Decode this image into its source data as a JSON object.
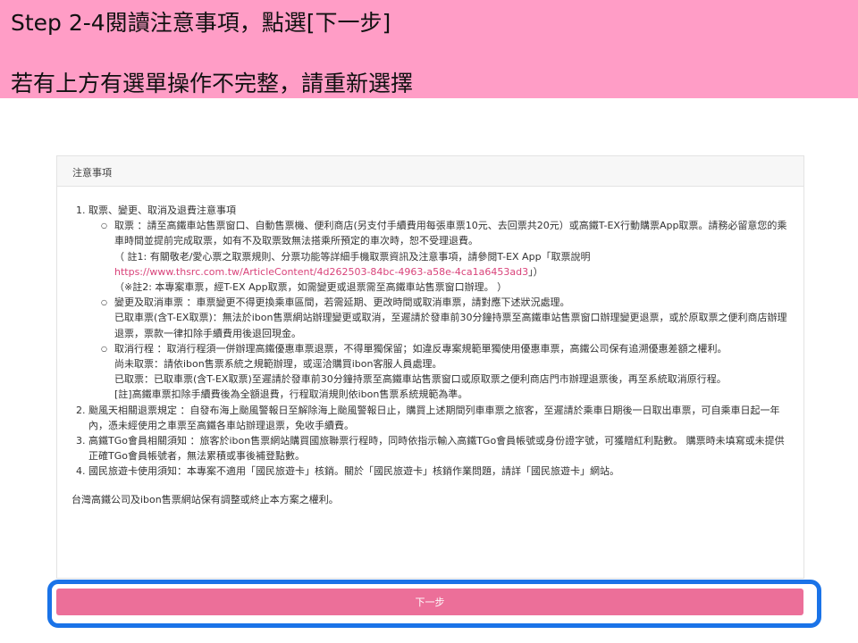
{
  "banner": {
    "line1": "Step 2-4閱讀注意事項，點選[下一步]",
    "line2": "若有上方有選單操作不完整，請重新選擇"
  },
  "panel": {
    "header": "注意事項",
    "items": [
      {
        "title": "取票、變更、取消及退費注意事項",
        "sub": [
          {
            "lines": [
              "取票 ：請至高鐵車站售票窗口、自動售票機、便利商店(另支付手續費用每張車票10元、去回票共20元）或高鐵T-EX行動購票App取票。請務必留意您的乘車時間並提前完成取票，如有不及取票致無法搭乘所預定的車次時，恕不受理退費。",
              "（ 註1: 有關敬老/愛心票之取票規則、分票功能等詳細手機取票資訊及注意事項，請參閱T-EX App「取票說明",
              "https://www.thsrc.com.tw/ArticleContent/4d262503-84bc-4963-a58e-4ca1a6453ad3",
              "」）",
              "（※註2: 本專案車票，經T-EX App取票，如需變更或退票需至高鐵車站售票窗口辦理。 ）"
            ]
          },
          {
            "lines": [
              "變更及取消車票 ：車票變更不得更換乘車區間，若需延期、更改時間或取消車票，請對應下述狀況處理。",
              "已取車票(含T-EX取票)：無法於ibon售票網站辦理變更或取消，至遲請於發車前30分鐘持票至高鐵車站售票窗口辦理變更退票，或於原取票之便利商店辦理退票，票款一律扣除手續費用後退回現金。"
            ]
          },
          {
            "lines": [
              "取消行程 ：取消行程須一併辦理高鐵優惠車票退票，不得單獨保留；如違反專案規範單獨使用優惠車票，高鐵公司保有追溯優惠差額之權利。",
              "尚未取票：請依ibon售票系統之規範辦理，或逕洽購買ibon客服人員處理。",
              "已取票：已取車票(含T-EX取票)至遲請於發車前30分鐘持票至高鐵車站售票窗口或原取票之便利商店門市辦理退票後，再至系統取消原行程。",
              "[註]高鐵車票扣除手續費後為全額退費，行程取消規則依ibon售票系統規範為準。"
            ]
          }
        ]
      },
      {
        "title": "颱風天相關退票規定 ：自發布海上颱風警報日至解除海上颱風警報日止，購買上述期間列車車票之旅客，至遲請於乘車日期後一日取出車票，可自乘車日起一年內，憑未經使用之車票至高鐵各車站辦理退票，免收手續費。"
      },
      {
        "title": "高鐵TGo會員相關須知 ：旅客於ibon售票網站購買國旅聯票行程時，同時依指示輸入高鐵TGo會員帳號或身份證字號，可獲贈紅利點數。 購票時未填寫或未提供正確TGo會員帳號者，無法累積或事後補登點數。"
      },
      {
        "title": "國民旅遊卡使用須知：本專案不適用「國民旅遊卡」核銷。關於「國民旅遊卡」核銷作業問題，請詳「國民旅遊卡」網站。"
      }
    ],
    "footer": "台灣高鐵公司及ibon售票網站保有調整或終止本方案之權利。"
  },
  "next_button": {
    "label": "下一步"
  },
  "colors": {
    "banner": "#ff9dc6",
    "button": "#ec6f99",
    "highlight": "#1a73e8",
    "link": "#d9437a"
  }
}
